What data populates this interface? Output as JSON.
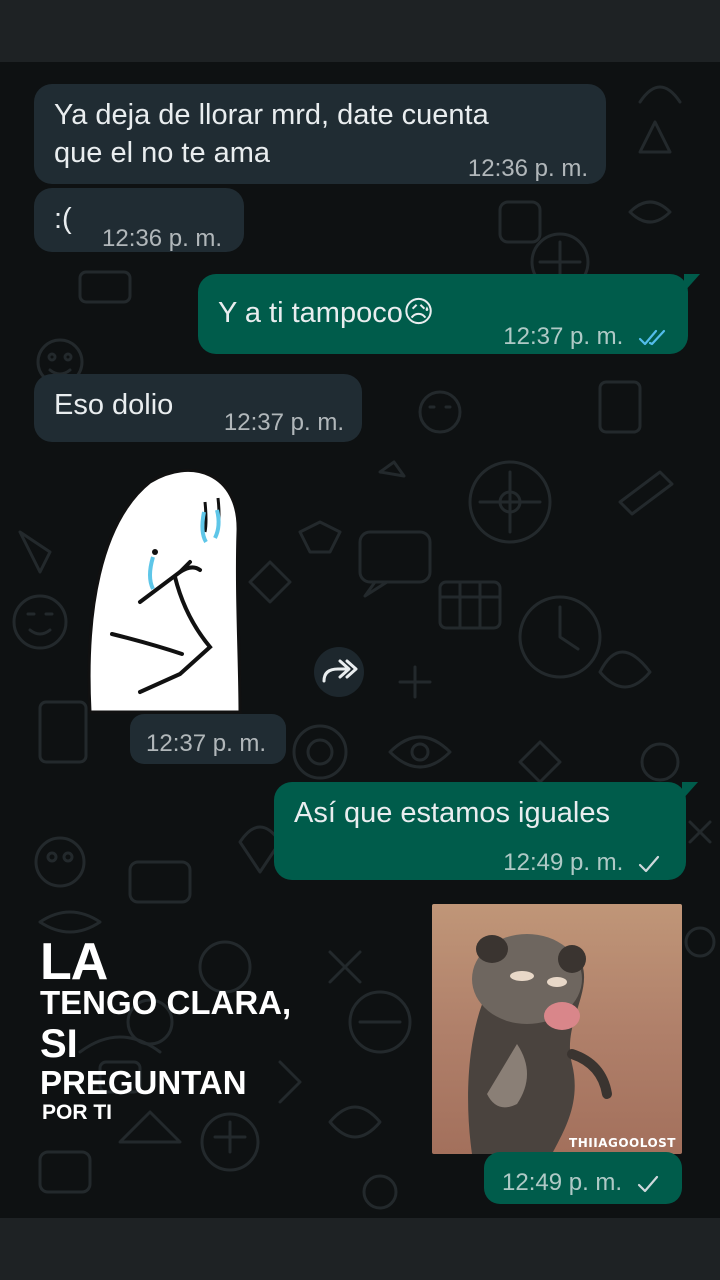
{
  "messages": {
    "m1": {
      "text_line1": "Ya deja de llorar mrd, date cuenta",
      "text_line2": "que el no te ama",
      "time": "12:36 p. m."
    },
    "m2": {
      "text": ":(",
      "time": "12:36 p. m."
    },
    "m3": {
      "text": "Y a ti tampoco",
      "emoji": "😥",
      "time": "12:37 p. m.",
      "status": "read"
    },
    "m4": {
      "text": "Eso dolio",
      "time": "12:37 p. m."
    },
    "m5": {
      "type": "sticker",
      "time": "12:37 p. m."
    },
    "m6": {
      "text": "Así que estamos iguales",
      "time": "12:49 p. m.",
      "status": "sent"
    },
    "m7": {
      "type": "gif",
      "watermark": "THIIAGOOLOST",
      "time": "12:49 p. m.",
      "status": "sent"
    }
  },
  "overlay": {
    "line1": "LA",
    "line2": "TENGO CLARA,",
    "line3": "SI",
    "line4": "PREGUNTAN",
    "line5": "POR TI"
  },
  "icons": {
    "forward": "forward-icon",
    "read_ticks": "double-check-icon",
    "sent_tick": "single-check-icon"
  },
  "colors": {
    "incoming_bubble": "#202c33",
    "outgoing_bubble": "#005c4b",
    "read_tick": "#53bdeb"
  }
}
